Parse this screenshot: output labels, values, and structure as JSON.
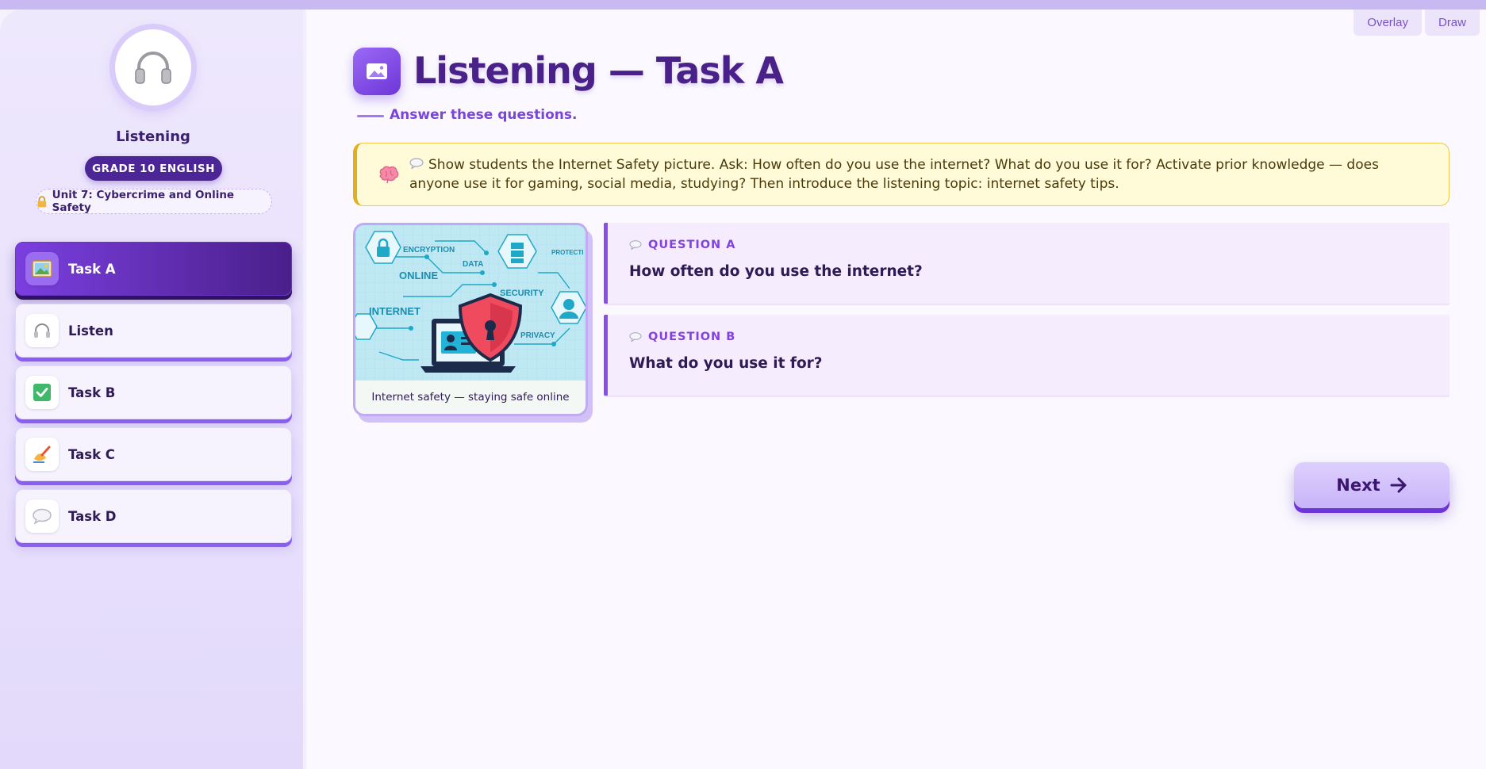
{
  "topbar": {
    "overlay_label": "Overlay",
    "draw_label": "Draw"
  },
  "sidebar": {
    "title": "Listening",
    "grade": "GRADE 10 ENGLISH",
    "unit": "Unit 7: Cybercrime and Online Safety",
    "items": [
      {
        "label": "Task A",
        "icon": "picture-icon",
        "active": true
      },
      {
        "label": "Listen",
        "icon": "headphones-icon",
        "active": false
      },
      {
        "label": "Task B",
        "icon": "check-box-icon",
        "active": false
      },
      {
        "label": "Task C",
        "icon": "writing-hand-icon",
        "active": false
      },
      {
        "label": "Task D",
        "icon": "speech-bubble-icon",
        "active": false
      }
    ]
  },
  "main": {
    "title": "Listening — Task A",
    "subtitle": "Answer these questions.",
    "tip": "Show students the Internet Safety picture. Ask: How often do you use the internet? What do you use it for? Activate prior knowledge — does anyone use it for gaming, social media, studying? Then introduce the listening topic: internet safety tips.",
    "image": {
      "caption": "Internet safety — staying safe online",
      "words": [
        "ENCRYPTION",
        "DATA",
        "ONLINE",
        "INTERNET",
        "SECURITY",
        "PRIVACY",
        "PROTECTI"
      ]
    },
    "questions": [
      {
        "label": "QUESTION A",
        "text": "How often do you use the internet?"
      },
      {
        "label": "QUESTION B",
        "text": "What do you use it for?"
      }
    ],
    "next_label": "Next"
  },
  "colors": {
    "accent": "#7b3fe0",
    "dark": "#4a2089",
    "tip_bg": "#fffbd8",
    "tip_border": "#f2c84a"
  }
}
